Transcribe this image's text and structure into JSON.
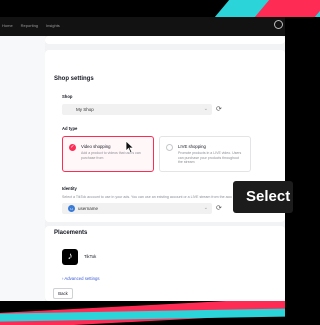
{
  "nav": {
    "items": [
      "Home",
      "Reporting",
      "Insights"
    ]
  },
  "shop_settings": {
    "title": "Shop settings",
    "shop_label": "Shop",
    "shop_value": "My Shop",
    "ad_type_label": "Ad type",
    "options": [
      {
        "title": "Video shopping",
        "description": "Add a product to videos that users can purchase from",
        "selected": true
      },
      {
        "title": "LIVE shopping",
        "description": "Promote products in a LIVE video. Users can purchase your products throughout the stream",
        "selected": false
      }
    ],
    "identity_label": "Identity",
    "identity_hint": "Select a TikTok account to use in your ads. You can use an existing account or a LIVE stream from the account as ad content.",
    "identity_value": "username"
  },
  "placements": {
    "title": "Placements",
    "item": "TikTok",
    "advanced": "Advanced settings",
    "back": "Back"
  },
  "overlay": {
    "select_text": "Select"
  },
  "colors": {
    "accent": "#fe2c55",
    "cyan": "#2bd4d8",
    "link": "#3b5bd5"
  },
  "icons": [
    "refresh-icon",
    "chevron-down-icon",
    "check-icon",
    "tiktok-logo-icon",
    "mouse-cursor-icon",
    "user-avatar-icon"
  ]
}
